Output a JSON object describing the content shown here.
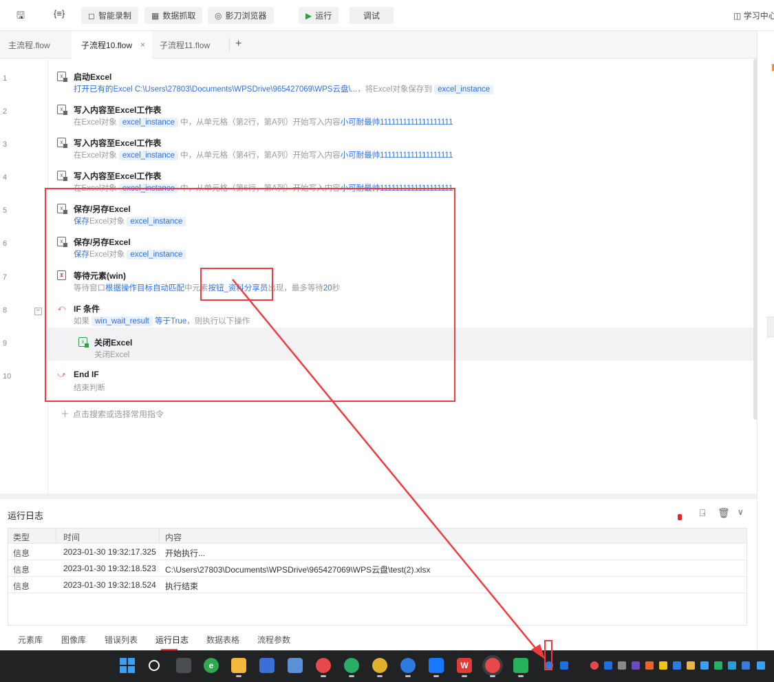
{
  "toolbar": {
    "record_label": "智能录制",
    "capture_label": "数据抓取",
    "browser_label": "影刀浏览器",
    "run_label": "运行",
    "debug_label": "调试",
    "learn_label": "学习中心"
  },
  "tabs": {
    "main": "主流程.flow",
    "sub10": "子流程10.flow",
    "sub11": "子流程11.flow",
    "close": "×",
    "add": "+"
  },
  "lines": [
    "1",
    "2",
    "3",
    "4",
    "5",
    "6",
    "7",
    "8",
    "9",
    "10"
  ],
  "fold_symbol": "−",
  "steps": {
    "s1": {
      "title": "启动Excel",
      "desc_pre": "打开已有的Excel C:\\Users\\27803\\Documents\\WPSDrive\\965427069\\WPS云盘\\...",
      "desc_mid": "，将Excel对象保存到",
      "var": "excel_instance"
    },
    "s2": {
      "title": "写入内容至Excel工作表",
      "pre": "在Excel对象",
      "var": "excel_instance",
      "mid": "中，从单元格（第",
      "row": "2",
      "mid2": "行，第",
      "col": "A",
      "mid3": "列）开始写入内容",
      "content": "小可耐最帅1111111111111111111"
    },
    "s3": {
      "title": "写入内容至Excel工作表",
      "pre": "在Excel对象",
      "var": "excel_instance",
      "mid": "中，从单元格（第",
      "row": "4",
      "mid2": "行，第",
      "col": "A",
      "mid3": "列）开始写入内容",
      "content": "小可耐最帅1111111111111111111"
    },
    "s4": {
      "title": "写入内容至Excel工作表",
      "pre": "在Excel对象",
      "var": "excel_instance",
      "mid": "中，从单元格（第",
      "row": "6",
      "mid2": "行，第",
      "col": "A",
      "mid3": "列）开始写入内容",
      "content": "小可耐最帅1111111111111111111"
    },
    "s5": {
      "title": "保存/另存Excel",
      "kw": "保存",
      "pre": "Excel对象",
      "var": "excel_instance"
    },
    "s6": {
      "title": "保存/另存Excel",
      "kw": "保存",
      "pre": "Excel对象",
      "var": "excel_instance"
    },
    "s7": {
      "title": "等待元素(win)",
      "pre": "等待窗口",
      "window": "根据操作目标自动匹配",
      "mid": "中元素",
      "element": "按钮_资料分享员",
      "mid2": "出现，最多等待",
      "secs": "20",
      "post": "秒"
    },
    "s8": {
      "title": "IF 条件",
      "pre": "如果",
      "var": "win_wait_result",
      "cond": "等于True",
      "post": "，则执行以下操作"
    },
    "s9": {
      "title": "关闭Excel",
      "desc": "关闭Excel"
    },
    "s10": {
      "title": "End IF",
      "desc": "结束判断"
    }
  },
  "add_command": "点击搜索或选择常用指令",
  "log": {
    "title": "运行日志",
    "headers": {
      "type": "类型",
      "time": "时间",
      "content": "内容"
    },
    "rows": [
      {
        "type": "信息",
        "time": "2023-01-30 19:32:17.325",
        "content": "开始执行..."
      },
      {
        "type": "信息",
        "time": "2023-01-30 19:32:18.523",
        "content": "C:\\Users\\27803\\Documents\\WPSDrive\\965427069\\WPS云盘\\test(2).xlsx"
      },
      {
        "type": "信息",
        "time": "2023-01-30 19:32:18.524",
        "content": "执行结束"
      }
    ]
  },
  "bottom_tabs": {
    "elements": "元素库",
    "images": "图像库",
    "errors": "错误列表",
    "runlog": "运行日志",
    "datatable": "数据表格",
    "params": "流程参数"
  },
  "taskbar": {
    "apps": [
      {
        "name": "search-icon",
        "color": "#202224"
      },
      {
        "name": "task-view-icon",
        "color": "#4a4d52"
      },
      {
        "name": "browser-360-icon",
        "color": "#2fa84f"
      },
      {
        "name": "file-explorer-icon",
        "color": "#f4b93b"
      },
      {
        "name": "remote-tool-icon",
        "color": "#3b6fd4"
      },
      {
        "name": "monitor-icon",
        "color": "#5b8fd6"
      },
      {
        "name": "yingdao-icon",
        "color": "#e84848"
      },
      {
        "name": "wechat-icon",
        "color": "#2aae67"
      },
      {
        "name": "chrome-icon",
        "color": "#e0b02a"
      },
      {
        "name": "quick-search-icon",
        "color": "#2e7be0"
      },
      {
        "name": "flow-app-icon",
        "color": "#1677ff"
      },
      {
        "name": "wps-icon",
        "color": "#e23a36"
      },
      {
        "name": "yingdao-active-icon",
        "color": "#e84848"
      },
      {
        "name": "green-app-icon",
        "color": "#26b15a"
      }
    ],
    "tray": [
      "#e84848",
      "#1e6fe0",
      "#d33",
      "#6a4bc4",
      "#e8642c",
      "#f0c419",
      "#2e7be0",
      "#e9b44c",
      "#3aa0f5",
      "#2aae67",
      "#2e9bd6",
      "#3a7bd5"
    ]
  }
}
